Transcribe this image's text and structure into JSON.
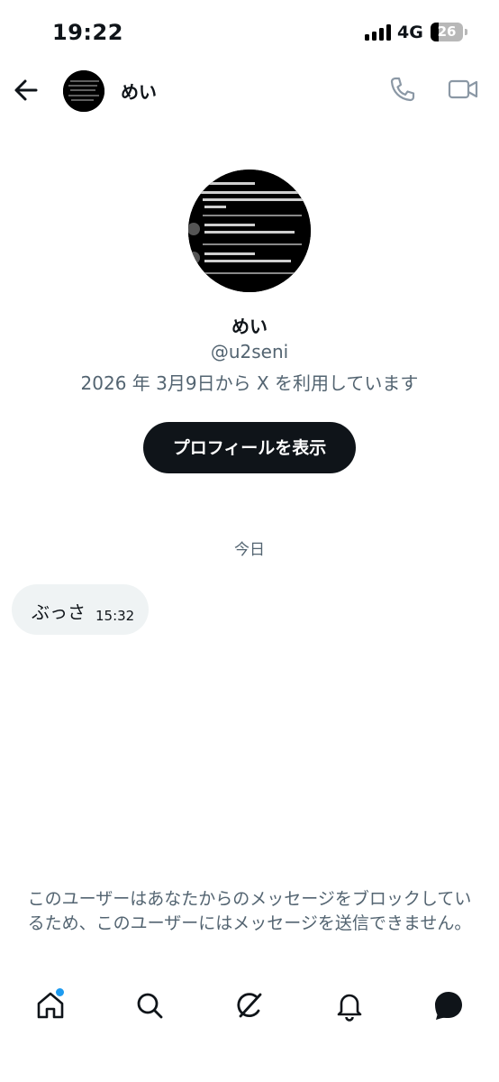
{
  "status_bar": {
    "time": "19:22",
    "network": "4G",
    "battery": "26",
    "battery_level": 0.26
  },
  "header": {
    "name": "めい",
    "icons": [
      "back-arrow-icon",
      "phone-icon",
      "video-icon"
    ]
  },
  "profile": {
    "name": "めい",
    "handle": "@u2seni",
    "joined": "2026 年 3月9日から X を利用しています",
    "button_label": "プロフィールを表示"
  },
  "conversation": {
    "date_separator": "今日",
    "messages": [
      {
        "text": "ぶっさ",
        "time": "15:32"
      }
    ]
  },
  "notice": "このユーザーはあなたからのメッセージをブロックしているため、このユーザーにはメッセージを送信できません。",
  "bottom_nav": {
    "items": [
      "home-icon",
      "search-icon",
      "grok-icon",
      "notifications-icon",
      "messages-icon"
    ],
    "accent_color": "#1d9bf0"
  },
  "colors": {
    "text": "#0f1419",
    "secondary": "#536471",
    "bubble": "#eff3f4",
    "button": "#0f1419"
  }
}
